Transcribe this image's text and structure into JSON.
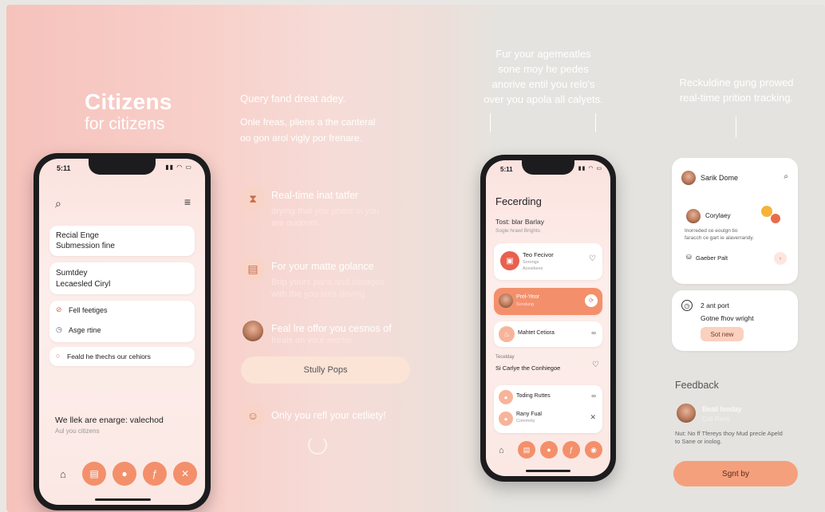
{
  "brand": {
    "title": "Citizens",
    "subtitle": "for citizens"
  },
  "intro": {
    "heading": "Query fand dreat adey.",
    "desc_line1": "Onle freas, pliens a the canteral",
    "desc_line2": "oo gon arol vigly por frenare."
  },
  "features": [
    {
      "icon": "hourglass-icon",
      "title": "Real-time inat tatfer",
      "desc1": "drying that you pnent in you",
      "desc2": "are oudonts."
    },
    {
      "icon": "document-icon",
      "title": "For your matte golance",
      "desc1": "Brip yours pans and clatages",
      "desc2": "with the you sots doving."
    },
    {
      "icon": "person-avatar",
      "title": "Feal lre offor you cesnos of",
      "desc1": "freals on your merter.",
      "desc2": ""
    },
    {
      "icon": "smile-icon",
      "title": "Only you refl your cetliety!",
      "desc1": "",
      "desc2": ""
    }
  ],
  "mid_button": "Stully Pops",
  "top_text_mid": {
    "l1": "Fur your agemeatles",
    "l2": "sone moy he pedes",
    "l3": "anorive entil you relo's",
    "l4": "over you apola all calyets."
  },
  "top_text_right": {
    "l1": "Reckuldine gung prowed",
    "l2": "real-time prition tracking."
  },
  "phone1": {
    "time": "5:11",
    "cards": [
      {
        "l1": "Recial Enge",
        "l2": "Submession fine"
      },
      {
        "l1": "Sumtdey",
        "l2": "Lecaesled Ciryl"
      }
    ],
    "list": [
      {
        "icon": "check-circle-icon",
        "label": "Fell feetiges"
      },
      {
        "icon": "clock-icon",
        "label": "Asge rtine"
      }
    ],
    "list2": "Feald he thechs our cehiors",
    "footer_title": "We llek are enarge: valechod",
    "footer_sub": "Aul you citizens",
    "nav": [
      "home-icon",
      "doc-icon",
      "person-icon",
      "pen-icon",
      "close-icon"
    ]
  },
  "phone2": {
    "time": "5:11",
    "title": "Fecerding",
    "sub1": "Tost: blar Barlay",
    "sub2": "Sogle hrawl Brights",
    "items": [
      {
        "t": "Teo Fecivor",
        "s1": "Sorongs",
        "s2": "Acesibees"
      },
      {
        "t": "Prel-Yeor",
        "s1": "Sondung"
      },
      {
        "t": "Mahtet Cetiora"
      }
    ],
    "section": "Tecelday",
    "section_item": "Si Carlye the Conhiegoe",
    "items2": [
      {
        "t": "Toding Ruttes"
      },
      {
        "t": "Rany Fual",
        "s": "Commoty"
      }
    ]
  },
  "right": {
    "card1": {
      "name": "Sarik Dome",
      "person": "Corylaey",
      "desc1": "Inorreded ce eoulgn tio",
      "desc2": "faracch ce gart ie alaverrandy.",
      "footer": "Gaeber Palt"
    },
    "card2": {
      "t1": "2 ant port",
      "t2": "Gotne fhov wright",
      "btn": "Sot new"
    },
    "feedback_title": "Feedback",
    "fb_name": "Beall feoday",
    "fb_sub": "Coll Rans",
    "fb_text1": "Nut: No ff Tfereys thoy Mud precle Apeld",
    "fb_text2": "to Sane or inolog.",
    "cta": "Sgnt by"
  },
  "colors": {
    "accent": "#f3906b",
    "accent_soft": "#f8d4c7"
  }
}
